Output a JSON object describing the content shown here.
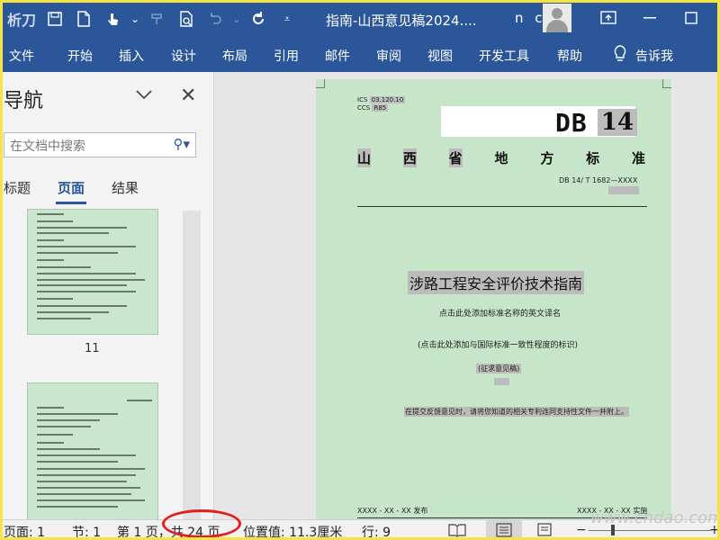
{
  "titlebar": {
    "app_logo": "析刀",
    "doc_title": "指南-山西意见稿2024....",
    "user_initials": "n c",
    "qat": [
      "save-icon",
      "new-doc-icon",
      "touch-mode-icon",
      "dropdown-icon",
      "format-painter-icon",
      "print-preview-icon",
      "undo-icon",
      "redo-icon",
      "customize-icon"
    ],
    "window_buttons": [
      "restore-ribbon-icon",
      "minimize-icon",
      "maximize-icon"
    ]
  },
  "ribbon": {
    "tabs": [
      "文件",
      "开始",
      "插入",
      "设计",
      "布局",
      "引用",
      "邮件",
      "审阅",
      "视图",
      "开发工具",
      "帮助"
    ],
    "tell_me": "告诉我"
  },
  "nav": {
    "title": "导航",
    "search_placeholder": "在文档中搜索",
    "tabs": [
      "标题",
      "页面",
      "结果"
    ],
    "active_tab": "页面",
    "thumb_page_number": "11"
  },
  "document": {
    "ics": "ICS",
    "ics_code": "03.120.10",
    "ccs": "CCS",
    "ccs_code": "R85",
    "db_label": "DB",
    "db_number": "14",
    "province_chars": [
      "山",
      "西",
      "省",
      "地",
      "方",
      "标",
      "准"
    ],
    "db_code": "DB 14/ T 1682—XXXX",
    "main_title": "涉路工程安全评价技术指南",
    "english_title_hint": "点击此处添加标准名称的英文译名",
    "intl_hint": "(点击此处添加与国际标准一致性程度的标识)",
    "draft_label": "(征求意见稿)",
    "feedback_note": "在提交反馈意见时，请将您知道的相关专利连同支持性文件一并附上。",
    "publish_date": "XXXX - XX - XX 发布",
    "implement_date": "XXXX - XX - XX 实施"
  },
  "status": {
    "page": "页面: 1",
    "section": "节: 1",
    "page_of": "第 1 页，共 24 页",
    "position": "位置值: 11.3厘米",
    "row": "行: 9",
    "view_icons": [
      "read-mode-icon",
      "print-layout-icon",
      "web-layout-icon"
    ],
    "zoom_minus": "−",
    "zoom_plus": "+"
  },
  "watermark": "www.cndao.com"
}
